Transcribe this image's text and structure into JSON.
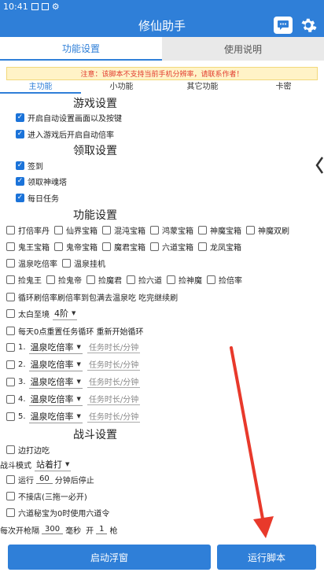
{
  "status": {
    "time": "10:41"
  },
  "app": {
    "title": "修仙助手",
    "chat_icon": "chat-icon",
    "settings_icon": "gear-icon"
  },
  "main_tabs": [
    {
      "label": "功能设置"
    },
    {
      "label": "使用说明"
    }
  ],
  "notice": "注意：该脚本不支持当前手机分辨率，请联系作者！",
  "sub_tabs": [
    {
      "label": "主功能"
    },
    {
      "label": "小功能"
    },
    {
      "label": "其它功能"
    },
    {
      "label": "卡密"
    }
  ],
  "sections": {
    "game": "游戏设置",
    "collect": "领取设置",
    "function": "功能设置",
    "battle": "战斗设置"
  },
  "game_settings": [
    {
      "label": "开启自动设置画面以及按键",
      "checked": true
    },
    {
      "label": "进入游戏后开启自动倍率",
      "checked": true
    }
  ],
  "collect_settings": [
    {
      "label": "签到",
      "checked": true
    },
    {
      "label": "领取神魂塔",
      "checked": true
    },
    {
      "label": "每日任务",
      "checked": true
    }
  ],
  "func_row1": [
    "打倍率丹",
    "仙界宝箱",
    "混沌宝箱",
    "鸿蒙宝箱",
    "神魔宝箱",
    "神魔双刷"
  ],
  "func_row2": [
    "鬼王宝箱",
    "鬼帝宝箱",
    "魔君宝箱",
    "六道宝箱",
    "龙凤宝箱"
  ],
  "func_row3": [
    "温泉吃倍率",
    "温泉挂机"
  ],
  "func_row4": [
    "捡鬼王",
    "捡鬼帝",
    "捡魔君",
    "捡六道",
    "捡神魔",
    "捡倍率"
  ],
  "func_row5": "循环刷倍率刷倍率到包满去温泉吃 吃完继续刷",
  "taibai": {
    "label": "太白至境",
    "value": "4阶"
  },
  "daily_reset": "每天0点重置任务循环 重新开始循环",
  "spring_tasks": [
    {
      "index": "1.",
      "value": "温泉吃倍率",
      "placeholder": "任务时长/分钟"
    },
    {
      "index": "2.",
      "value": "温泉吃倍率",
      "placeholder": "任务时长/分钟"
    },
    {
      "index": "3.",
      "value": "温泉吃倍率",
      "placeholder": "任务时长/分钟"
    },
    {
      "index": "4.",
      "value": "温泉吃倍率",
      "placeholder": "任务时长/分钟"
    },
    {
      "index": "5.",
      "value": "温泉吃倍率",
      "placeholder": "任务时长/分钟"
    }
  ],
  "battle": {
    "fight_dodge": "边打边吃",
    "mode_label": "战斗模式",
    "mode_value": "站着打",
    "run_prefix": "运行",
    "run_value": "60",
    "run_suffix": "分钟后停止",
    "no_team": "不接店(三拖一必开)",
    "liudao": "六道秘宝为0时使用六道令",
    "interval_prefix": "每次开枪隔",
    "interval_value": "300",
    "interval_unit": "毫秒",
    "shots_prefix": "开",
    "shots_value": "1",
    "shots_suffix": "枪"
  },
  "buttons": {
    "float": "启动浮窗",
    "run": "运行脚本"
  },
  "colors": {
    "primary": "#2f7fd8",
    "notice_text": "#e23b2e",
    "arrow": "#e8392b"
  }
}
